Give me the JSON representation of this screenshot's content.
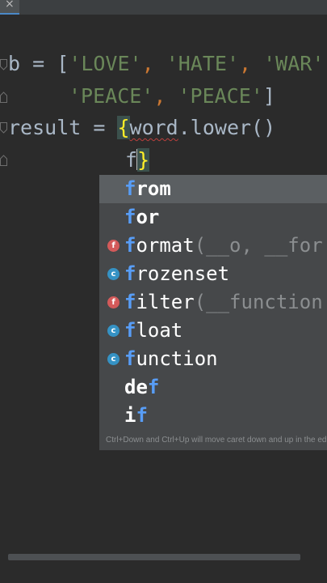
{
  "tabs": [
    {
      "close": "×"
    }
  ],
  "code": {
    "line1": {
      "p1": "b = [",
      "s1": "'LOVE'",
      "c1": ", ",
      "s2": "'HATE'",
      "c2": ", ",
      "s3": "'WAR'",
      "c3": ","
    },
    "line2": {
      "s4": "'PEACE'",
      "c4": ", ",
      "s5": "'PEACE'",
      "p2": "]"
    },
    "line3": {
      "p1": "result = ",
      "brace": "{",
      "word": "word",
      "rest": ".lower()"
    },
    "line4": {
      "typed": "f",
      "brace": "}"
    }
  },
  "completion": {
    "items": [
      {
        "match": "f",
        "rest": "rom",
        "kind": "keyword"
      },
      {
        "match": "f",
        "rest": "or",
        "kind": "keyword"
      },
      {
        "icon_letter": "f",
        "match": "f",
        "rest": "ormat",
        "tail": "(__o, __for",
        "kind": "function"
      },
      {
        "icon_letter": "c",
        "match": "f",
        "rest": "rozenset",
        "kind": "class"
      },
      {
        "icon_letter": "f",
        "match": "f",
        "rest": "ilter",
        "tail": "(__function",
        "kind": "function"
      },
      {
        "icon_letter": "c",
        "match": "f",
        "rest": "loat",
        "kind": "class"
      },
      {
        "icon_letter": "c",
        "match": "f",
        "rest": "unction",
        "kind": "class"
      },
      {
        "pre": "de",
        "match": "f",
        "rest": "",
        "kind": "keyword"
      },
      {
        "pre": "i",
        "match": "f",
        "rest": "",
        "kind": "keyword"
      }
    ],
    "selected_index": 0,
    "hint": "Ctrl+Down and Ctrl+Up will move caret down and up in the editor"
  },
  "colors": {
    "background": "#2b2b2b",
    "string": "#6a8759",
    "keyword": "#cc7832",
    "match": "#589df6"
  }
}
